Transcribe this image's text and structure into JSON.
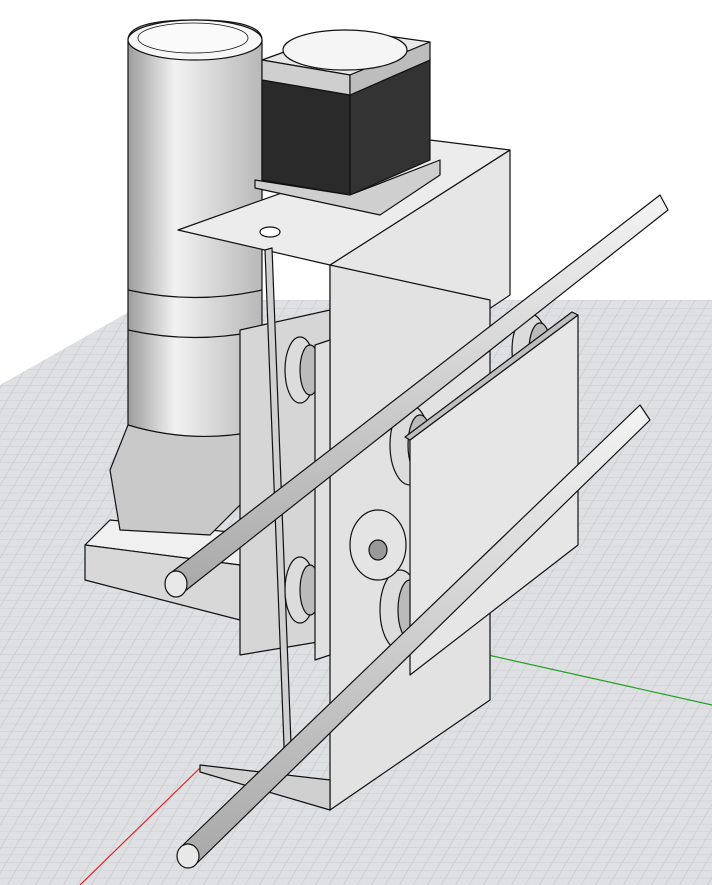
{
  "viewport": {
    "background_color": "#ffffff",
    "grid_plane_color": "#dfe0e3",
    "grid_line_color": "#c4c6ca",
    "x_axis_color": "#e02020",
    "y_axis_color": "#20a020",
    "model_fill_light": "#eeeeee",
    "model_fill_mid": "#cfcfcf",
    "model_fill_dark": "#9a9a9a",
    "motor_body_color": "#2a2a2a",
    "edge_color": "#111111"
  }
}
